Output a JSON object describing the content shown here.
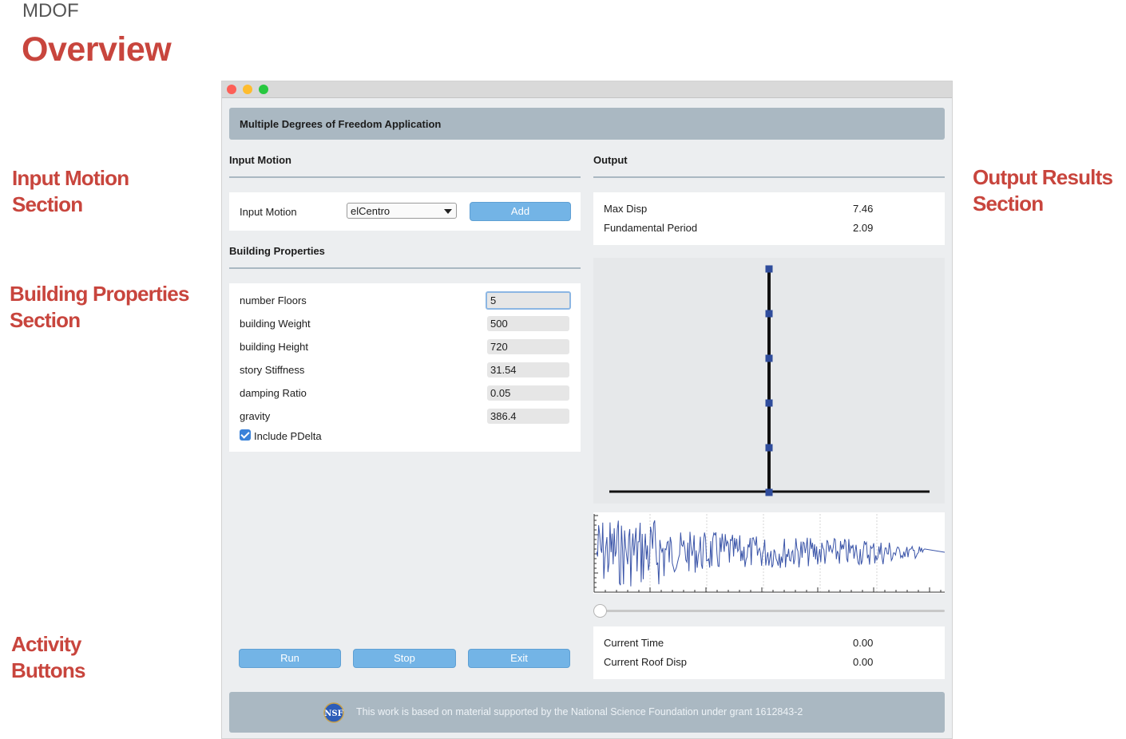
{
  "page": {
    "sup_label": "MDOF",
    "title": "Overview",
    "annotations": {
      "input_motion": [
        "Input Motion",
        "Section"
      ],
      "building_properties": [
        "Building Properties",
        "Section"
      ],
      "activity": [
        "Activity",
        "Buttons"
      ],
      "output_results": [
        "Output Results",
        "Section"
      ]
    }
  },
  "app": {
    "header": "Multiple Degrees of Freedom Application",
    "input_section": {
      "title": "Input Motion",
      "label": "Input Motion",
      "selected": "elCentro",
      "add_label": "Add"
    },
    "building_section": {
      "title": "Building Properties",
      "fields": [
        {
          "label": "number Floors",
          "value": "5"
        },
        {
          "label": "building Weight",
          "value": "500"
        },
        {
          "label": "building Height",
          "value": "720"
        },
        {
          "label": "story Stiffness",
          "value": "31.54"
        },
        {
          "label": "damping Ratio",
          "value": "0.05"
        },
        {
          "label": "gravity",
          "value": "386.4"
        }
      ],
      "pdelta_label": "Include PDelta",
      "pdelta_checked": true
    },
    "buttons": {
      "run": "Run",
      "stop": "Stop",
      "exit": "Exit"
    },
    "output_section": {
      "title": "Output",
      "max_disp_label": "Max Disp",
      "max_disp_value": "7.46",
      "period_label": "Fundamental Period",
      "period_value": "2.09",
      "current_time_label": "Current Time",
      "current_time_value": "0.00",
      "roof_disp_label": "Current Roof Disp",
      "roof_disp_value": "0.00",
      "time_slider": 0.0
    },
    "footer_text": "This work is based on material supported by the National Science Foundation under grant 1612843-2",
    "colors": {
      "accent": "#c8453d",
      "button": "#73b4e6",
      "header": "#aab8c2",
      "plot_line": "#3a54a8"
    }
  }
}
